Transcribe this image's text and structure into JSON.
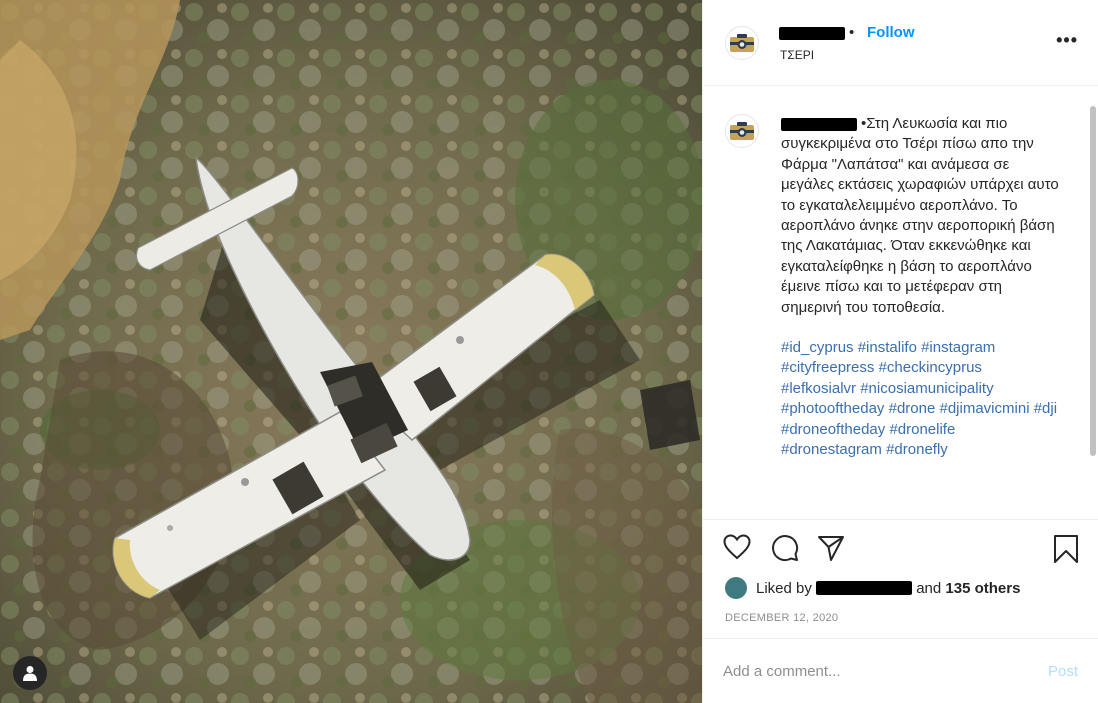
{
  "post": {
    "location": "ΤΣΕΡΙ",
    "follow_label": "Follow",
    "dot": "•",
    "more_label": "•••",
    "caption": "•Στη Λευκωσία και πιο συγκεκριμένα στο Τσέρι πίσω απο την Φάρμα \"Λαπάτσα\" και ανάμεσα σε μεγάλες εκτάσεις χωραφιών υπάρχει αυτο το εγκαταλελειμμένο αεροπλάνο. Το αεροπλάνο άνηκε στην αεροπορική βάση της Λακατάμιας. Όταν εκκενώθηκε και εγκαταλείφθηκε η βάση το αεροπλάνο έμεινε πίσω και το μετέφεραν στη σημερινή του τοποθεσία.",
    "hashtags": [
      "#id_cyprus",
      "#instalifo",
      "#instagram",
      "#cityfreepress",
      "#checkincyprus",
      "#lefkosialvr",
      "#nicosiamunicipality",
      "#photooftheday",
      "#drone",
      "#djimavicmini",
      "#dji",
      "#droneoftheday",
      "#dronelife",
      "#dronestagram",
      "#dronefly"
    ],
    "likes": {
      "prefix": "Liked by",
      "and_label": "and",
      "others": "135 others"
    },
    "date": "DECEMBER 12, 2020",
    "comment_placeholder": "Add a comment...",
    "post_label": "Post"
  },
  "icons": {
    "heart": "heart-icon",
    "comment": "comment-icon",
    "share": "paper-plane-icon",
    "save": "bookmark-icon",
    "next": "chevron-right-icon",
    "user_tag": "user-tag-icon"
  },
  "colors": {
    "link_blue": "#0095f6",
    "hashtag": "#3a6fb0",
    "muted": "#8e8e8e",
    "post_disabled": "#b2dffc"
  }
}
